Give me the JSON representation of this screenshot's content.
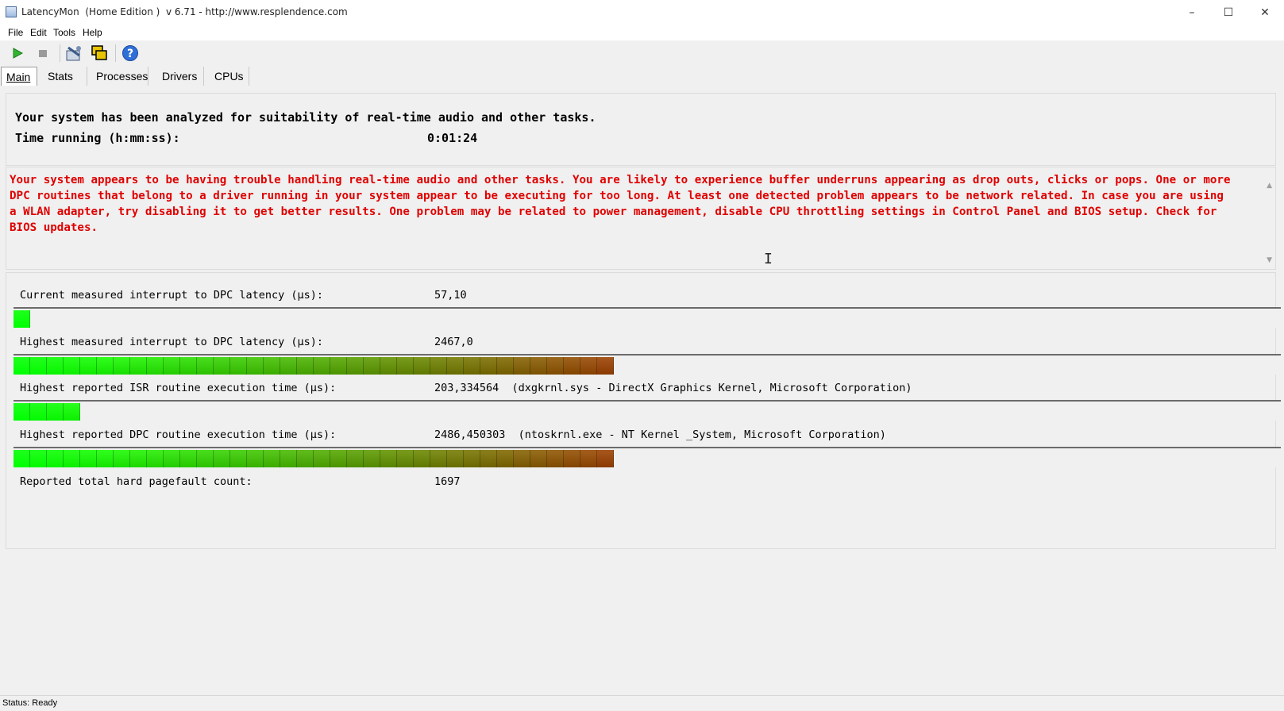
{
  "window": {
    "title": "LatencyMon  (Home Edition )  v 6.71 - http://www.resplendence.com",
    "controls": {
      "minimize": "–",
      "maximize": "☐",
      "close": "✕"
    }
  },
  "menu": {
    "file": "File",
    "edit": "Edit",
    "tools": "Tools",
    "help": "Help"
  },
  "toolbar": {
    "start_icon": "play-icon",
    "stop_icon": "stop-icon",
    "analyze_icon": "wrench-icon",
    "windows_icon": "windows-icon",
    "help_icon": "help-icon"
  },
  "tabs": [
    {
      "label": "Main",
      "active": true
    },
    {
      "label": "Stats"
    },
    {
      "label": "Processes"
    },
    {
      "label": "Drivers"
    },
    {
      "label": "CPUs"
    }
  ],
  "summary": {
    "line1": "Your system has been analyzed for suitability of real-time audio and other tasks.",
    "time_label": "Time running (h:mm:ss):",
    "time_value": "0:01:24"
  },
  "warning": {
    "text": "Your system appears to be having trouble handling real-time audio and other tasks. You are likely to experience buffer underruns appearing as drop outs, clicks or pops. One or more DPC routines that belong to a driver running in your system appear to be executing for too long. At least one detected problem appears to be network related. In case you are using a WLAN adapter, try disabling it to get better results. One problem may be related to power management, disable CPU throttling settings in Control Panel and BIOS setup. Check for BIOS updates.",
    "color": "#e00000"
  },
  "metrics": [
    {
      "label": "Current measured interrupt to DPC latency (µs):",
      "value": "57,10",
      "bar_fraction": 0.012
    },
    {
      "label": "Highest measured interrupt to DPC latency (µs):",
      "value": "2467,0",
      "bar_fraction": 0.471
    },
    {
      "label": "Highest reported ISR routine execution time (µs):",
      "value": "203,334564  (dxgkrnl.sys - DirectX Graphics Kernel, Microsoft Corporation)",
      "bar_fraction": 0.055
    },
    {
      "label": "Highest reported DPC routine execution time (µs):",
      "value": "2486,450303  (ntoskrnl.exe - NT Kernel _System, Microsoft Corporation)",
      "bar_fraction": 0.48
    },
    {
      "label": "Reported total hard pagefault count:",
      "value": "1697"
    }
  ],
  "bar_colors": {
    "start": "#00ff00",
    "end": "#8a3a00"
  },
  "status": {
    "text": "Status: Ready"
  }
}
